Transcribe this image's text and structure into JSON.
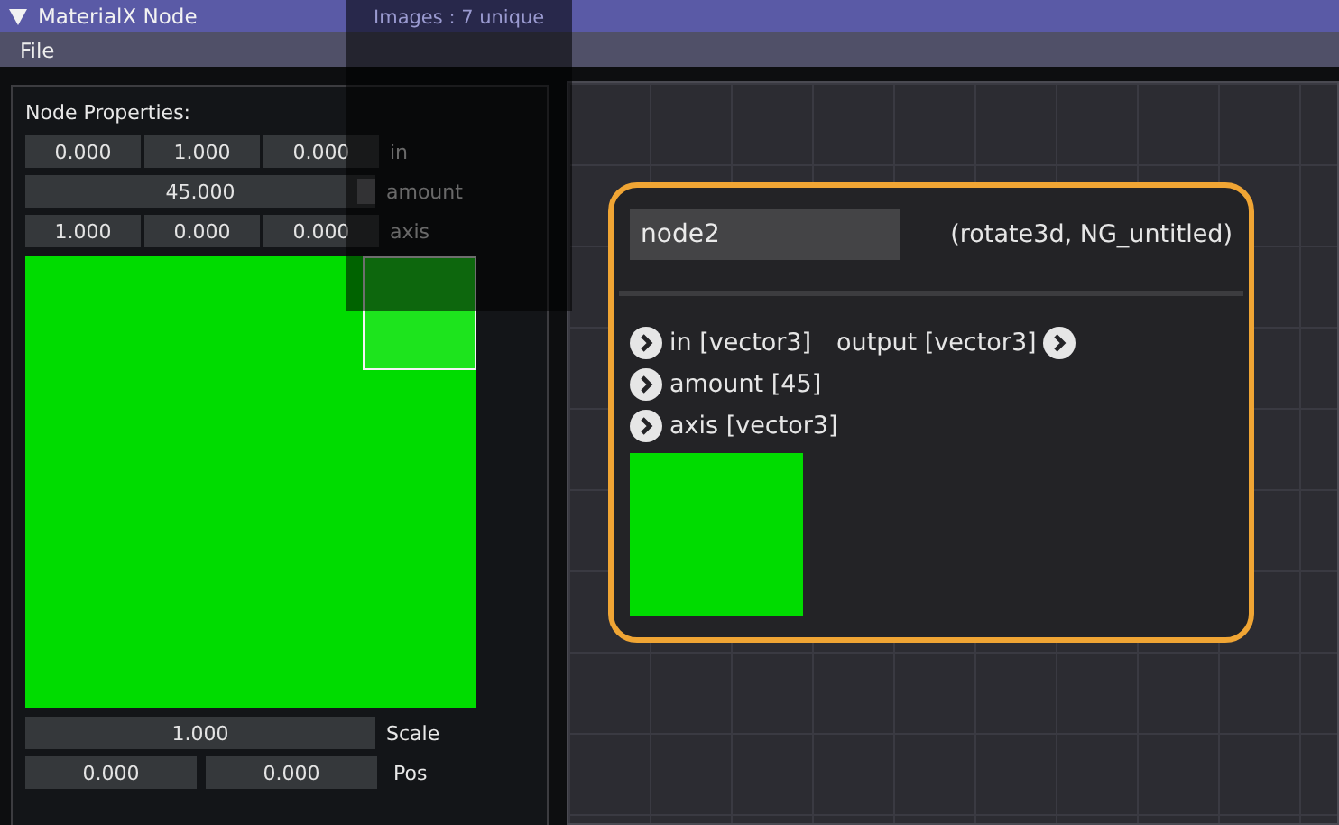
{
  "window": {
    "title": "MaterialX Node",
    "expanded": true
  },
  "menu": [
    "File"
  ],
  "properties": {
    "heading": "Node Properties:",
    "rows": [
      {
        "kind": "vector",
        "label": "in",
        "values": [
          "0.000",
          "1.000",
          "0.000"
        ]
      },
      {
        "kind": "slider",
        "label": "amount",
        "value": "45.000",
        "level": 1
      },
      {
        "kind": "vector",
        "label": "axis",
        "values": [
          "1.000",
          "0.000",
          "0.000"
        ]
      }
    ],
    "scale": {
      "label": "Scale",
      "value": "1.000"
    },
    "pos": {
      "label": "Pos",
      "values": [
        "0.000",
        "0.000"
      ]
    }
  },
  "stats": [
    "Images : 7 unique"
  ],
  "node": {
    "name": "node2",
    "type": "(rotate3d, NG_untitled)",
    "selected": true,
    "inputs": [
      "in [vector3]",
      "amount [45]",
      "axis [vector3]"
    ],
    "output": "output [vector3]"
  }
}
